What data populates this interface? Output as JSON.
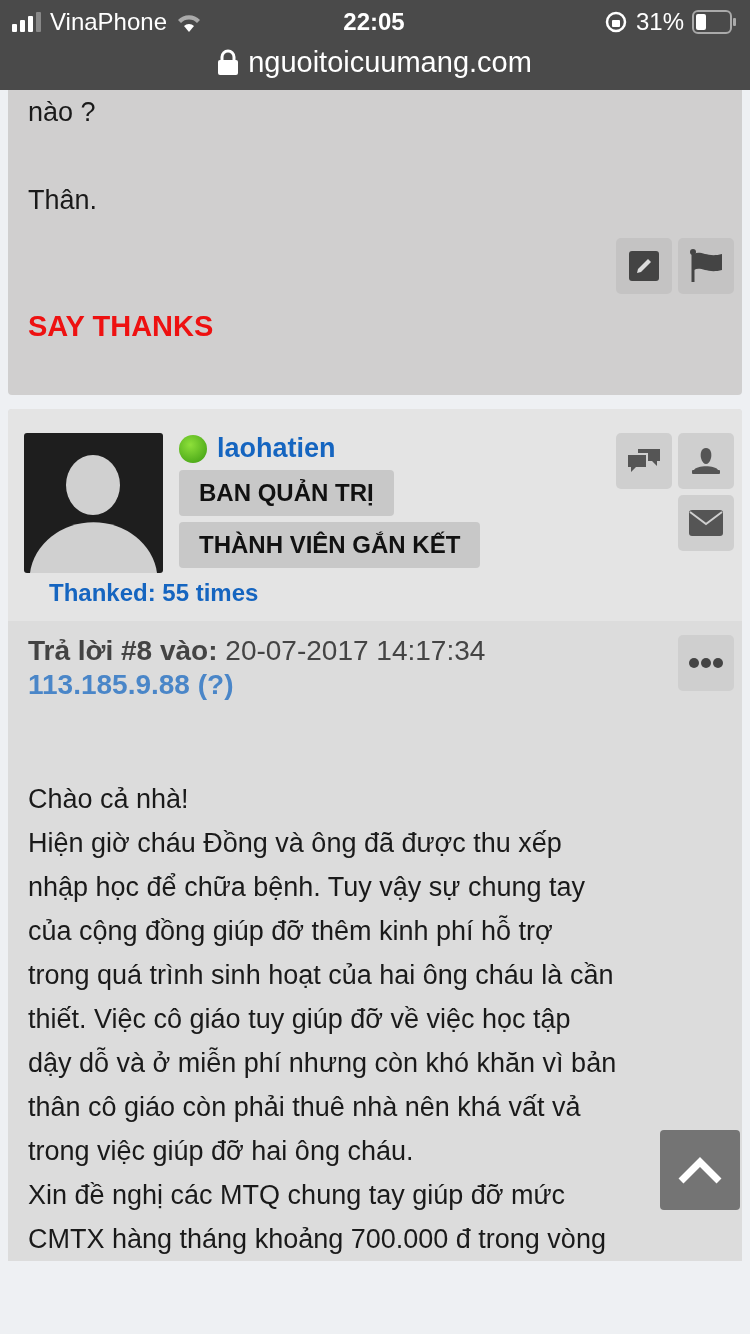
{
  "status_bar": {
    "carrier": "VinaPhone",
    "time": "22:05",
    "battery": "31%",
    "url": "nguoitoicuumang.com"
  },
  "previous_post": {
    "lines": [
      "nào ?",
      "Thân."
    ],
    "say_thanks": "SAY THANKS"
  },
  "post": {
    "username": "laohatien",
    "online": true,
    "ranks": [
      "BAN QUẢN TRỊ",
      "THÀNH VIÊN GẮN KẾT"
    ],
    "thanked": "Thanked: 55 times",
    "reply_label": "Trả lời #8 vào:",
    "date": "20-07-2017 14:17:34",
    "ip": "113.185.9.88 (?)",
    "lines": [
      "Chào cả nhà!",
      "Hiện giờ cháu Đồng và ông đã được thu xếp",
      "nhập học để  chữa bệnh. Tuy vậy sự chung tay",
      "của cộng đồng giúp đỡ thêm kinh phí hỗ trợ",
      "trong quá trình sinh hoạt của hai ông cháu là cần",
      "thiết. Việc cô giáo tuy giúp đỡ về việc học tập",
      "dậy dỗ và ở miễn phí nhưng còn khó khăn vì bản",
      "thân cô giáo còn phải thuê nhà nên khá vất vả",
      "trong việc giúp đỡ hai ông cháu.",
      "Xin đề nghị các MTQ chung tay giúp đỡ mức",
      "CMTX hàng tháng khoảng 700.000 đ trong vòng"
    ]
  }
}
